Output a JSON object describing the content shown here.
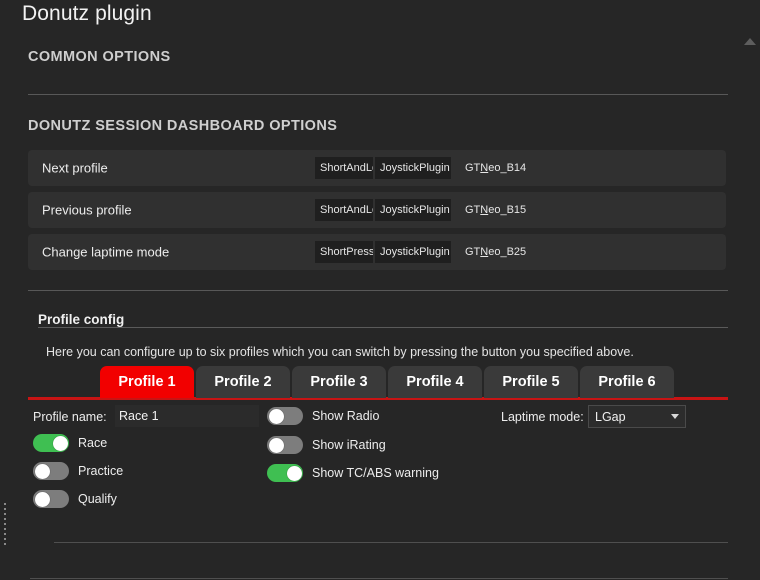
{
  "window": {
    "title": "Donutz plugin"
  },
  "sections": {
    "common_options": "COMMON OPTIONS",
    "dashboard_options": "DONUTZ SESSION DASHBOARD OPTIONS"
  },
  "actions": [
    {
      "label": "Next profile",
      "press_type": "ShortAndLo",
      "plugin": "JoystickPlugin",
      "binding_prefix": "GT",
      "binding_mnemonic": "N",
      "binding_suffix": "eo_B14"
    },
    {
      "label": "Previous profile",
      "press_type": "ShortAndLo",
      "plugin": "JoystickPlugin",
      "binding_prefix": "GT",
      "binding_mnemonic": "N",
      "binding_suffix": "eo_B15"
    },
    {
      "label": "Change laptime mode",
      "press_type": "ShortPress",
      "plugin": "JoystickPlugin",
      "binding_prefix": "GT",
      "binding_mnemonic": "N",
      "binding_suffix": "eo_B25"
    }
  ],
  "profile_config": {
    "title": "Profile config",
    "description": "Here you can configure up to six profiles which you can switch by pressing the button you specified above.",
    "tabs": [
      {
        "label": "Profile 1",
        "active": true
      },
      {
        "label": "Profile 2",
        "active": false
      },
      {
        "label": "Profile 3",
        "active": false
      },
      {
        "label": "Profile 4",
        "active": false
      },
      {
        "label": "Profile 5",
        "active": false
      },
      {
        "label": "Profile 6",
        "active": false
      }
    ],
    "profile_name_label": "Profile name:",
    "profile_name_value": "Race 1",
    "laptime_mode_label": "Laptime mode:",
    "laptime_mode_value": "LGap",
    "session_toggles": [
      {
        "label": "Race",
        "on": true
      },
      {
        "label": "Practice",
        "on": false
      },
      {
        "label": "Qualify",
        "on": false
      }
    ],
    "display_toggles": [
      {
        "label": "Show Radio",
        "on": false
      },
      {
        "label": "Show iRating",
        "on": false
      },
      {
        "label": "Show TC/ABS warning",
        "on": true
      }
    ]
  },
  "icons": {
    "scroll_up": "scroll-up-arrow",
    "dropdown_caret": "chevron-down-icon",
    "splitter": "splitter-handle"
  },
  "colors": {
    "background": "#262626",
    "row_background": "#303030",
    "accent_red": "#f20000",
    "underline_red": "#c81414",
    "toggle_on_green": "#3fbf52",
    "toggle_off_gray": "#7d7d7d",
    "text_primary": "#ededed",
    "text_heading": "#cfcfcf"
  }
}
